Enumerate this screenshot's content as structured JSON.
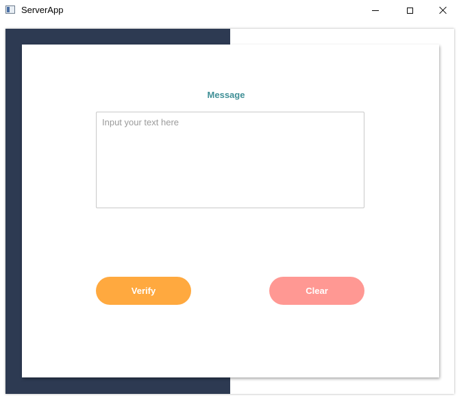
{
  "window": {
    "title": "ServerApp",
    "icon": "app-window-icon",
    "controls": {
      "minimize_icon": "minimize-icon",
      "maximize_icon": "maximize-icon",
      "close_icon": "close-icon"
    }
  },
  "form": {
    "message_label": "Message",
    "message_value": "",
    "message_placeholder": "Input your text here",
    "verify_label": "Verify",
    "clear_label": "Clear"
  },
  "colors": {
    "side_panel": "#2d3a52",
    "label": "#3f8f96",
    "verify_button": "#ffa93f",
    "clear_button": "#ff9893"
  }
}
